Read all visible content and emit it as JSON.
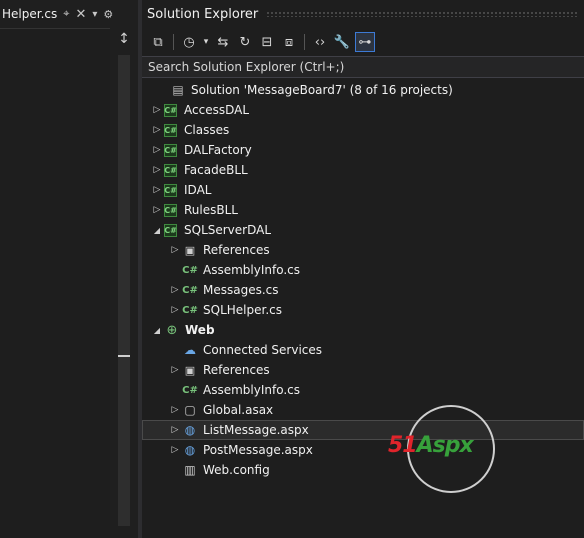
{
  "document_tab": {
    "title": "Helper.cs",
    "pin_icon": "pin-icon",
    "close_icon": "close-icon",
    "dropdown_icon": "chevron-down-icon",
    "settings_icon": "gear-icon"
  },
  "solution_explorer": {
    "title": "Solution Explorer",
    "search_placeholder": "Search Solution Explorer (Ctrl+;)",
    "toolbar": [
      {
        "icon": "switch-views-icon",
        "glyph": "⧉",
        "active": false
      },
      {
        "icon": "pending-changes-filter-icon",
        "glyph": "◷",
        "active": false
      },
      {
        "icon": "chevron-down-icon",
        "glyph": "▾",
        "active": false
      },
      {
        "icon": "sync-active-document-icon",
        "glyph": "⇆",
        "active": false
      },
      {
        "icon": "refresh-icon",
        "glyph": "↻",
        "active": false
      },
      {
        "icon": "collapse-all-icon",
        "glyph": "⊟",
        "active": false
      },
      {
        "icon": "show-all-files-icon",
        "glyph": "⧈",
        "active": false
      },
      {
        "icon": "view-code-icon",
        "glyph": "‹›",
        "active": false
      },
      {
        "icon": "properties-wrench-icon",
        "glyph": "🔧",
        "active": false
      },
      {
        "icon": "preview-selected-items-icon",
        "glyph": "⊶",
        "active": true
      }
    ],
    "tree": [
      {
        "label": "Solution 'MessageBoard7' (8 of 16 projects)",
        "level": 0,
        "expander": "",
        "icon": "solution-icon",
        "kind": "sln"
      },
      {
        "label": "AccessDAL",
        "level": 1,
        "expander": "collapsed",
        "icon": "csharp-project-icon",
        "kind": "cs"
      },
      {
        "label": "Classes",
        "level": 1,
        "expander": "collapsed",
        "icon": "csharp-project-icon",
        "kind": "cs"
      },
      {
        "label": "DALFactory",
        "level": 1,
        "expander": "collapsed",
        "icon": "csharp-project-icon",
        "kind": "cs"
      },
      {
        "label": "FacadeBLL",
        "level": 1,
        "expander": "collapsed",
        "icon": "csharp-project-icon",
        "kind": "cs"
      },
      {
        "label": "IDAL",
        "level": 1,
        "expander": "collapsed",
        "icon": "csharp-project-icon",
        "kind": "cs"
      },
      {
        "label": "RulesBLL",
        "level": 1,
        "expander": "collapsed",
        "icon": "csharp-project-icon",
        "kind": "cs"
      },
      {
        "label": "SQLServerDAL",
        "level": 1,
        "expander": "expanded",
        "icon": "csharp-project-icon",
        "kind": "cs"
      },
      {
        "label": "References",
        "level": 2,
        "expander": "collapsed",
        "icon": "references-icon",
        "kind": "ref"
      },
      {
        "label": "AssemblyInfo.cs",
        "level": 2,
        "expander": "",
        "icon": "csharp-file-icon",
        "kind": "csfile"
      },
      {
        "label": "Messages.cs",
        "level": 2,
        "expander": "collapsed",
        "icon": "csharp-file-icon",
        "kind": "csfile"
      },
      {
        "label": "SQLHelper.cs",
        "level": 2,
        "expander": "collapsed",
        "icon": "csharp-file-icon",
        "kind": "csfile"
      },
      {
        "label": "Web",
        "level": 1,
        "expander": "expanded",
        "icon": "web-project-icon",
        "kind": "web",
        "bold": true
      },
      {
        "label": "Connected Services",
        "level": 2,
        "expander": "",
        "icon": "connected-services-icon",
        "kind": "cloud"
      },
      {
        "label": "References",
        "level": 2,
        "expander": "collapsed",
        "icon": "references-icon",
        "kind": "ref"
      },
      {
        "label": "AssemblyInfo.cs",
        "level": 2,
        "expander": "",
        "icon": "csharp-file-icon",
        "kind": "csfile"
      },
      {
        "label": "Global.asax",
        "level": 2,
        "expander": "collapsed",
        "icon": "global-asax-icon",
        "kind": "page"
      },
      {
        "label": "ListMessage.aspx",
        "level": 2,
        "expander": "collapsed",
        "icon": "aspx-page-icon",
        "kind": "globe",
        "selected": true
      },
      {
        "label": "PostMessage.aspx",
        "level": 2,
        "expander": "collapsed",
        "icon": "aspx-page-icon",
        "kind": "globe"
      },
      {
        "label": "Web.config",
        "level": 2,
        "expander": "",
        "icon": "config-file-icon",
        "kind": "cfg"
      }
    ]
  },
  "watermark": {
    "brand_red": "51",
    "brand_green": "Aspx",
    "colors": {
      "red": "#e0242b",
      "green": "#37a13b"
    }
  },
  "colors": {
    "background": "#1e1e1e",
    "selection_outline": "#4a4a4a",
    "active_tool_outline": "#3d7ad5"
  }
}
